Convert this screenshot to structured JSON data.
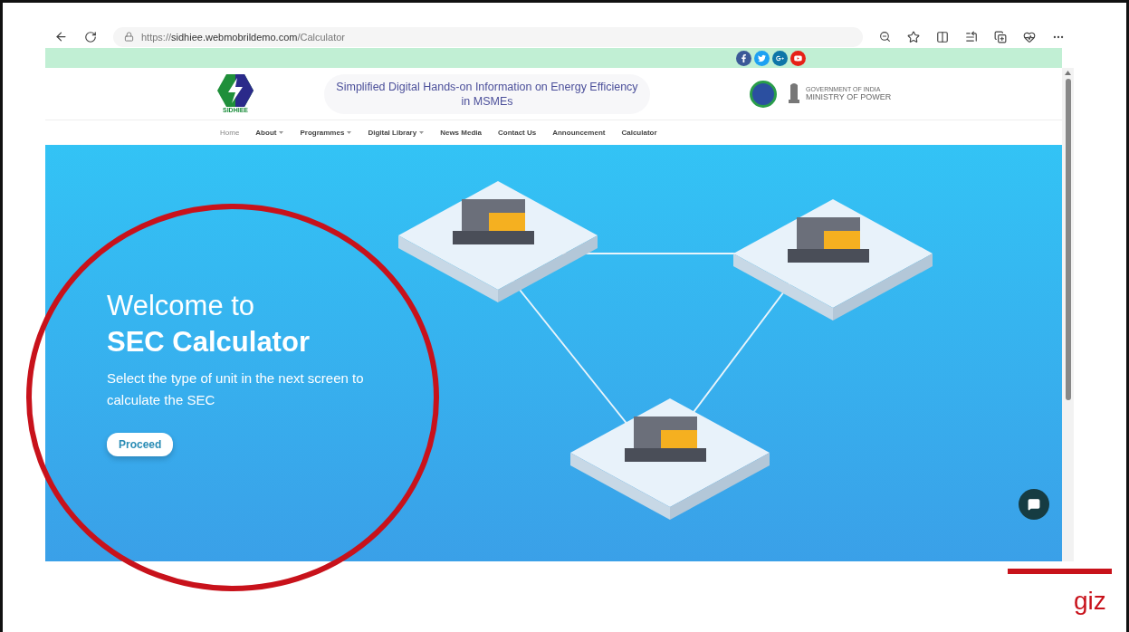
{
  "browser": {
    "url_prefix": "https://",
    "url_host": "sidhiee.webmobrildemo.com",
    "url_path": "/Calculator"
  },
  "site": {
    "logo_text": "SIDHIEE",
    "title": "Simplified Digital Hands-on Information on Energy Efficiency in MSMEs",
    "ministry_small": "GOVERNMENT OF INDIA",
    "ministry": "MINISTRY OF POWER"
  },
  "nav": [
    {
      "label": "Home",
      "selected": true,
      "dropdown": false
    },
    {
      "label": "About",
      "selected": false,
      "dropdown": true
    },
    {
      "label": "Programmes",
      "selected": false,
      "dropdown": true
    },
    {
      "label": "Digital Library",
      "selected": false,
      "dropdown": true
    },
    {
      "label": "News Media",
      "selected": false,
      "dropdown": false
    },
    {
      "label": "Contact Us",
      "selected": false,
      "dropdown": false
    },
    {
      "label": "Announcement",
      "selected": false,
      "dropdown": false
    },
    {
      "label": "Calculator",
      "selected": false,
      "dropdown": false
    }
  ],
  "social": [
    {
      "kind": "facebook",
      "color": "#3b5998"
    },
    {
      "kind": "twitter",
      "color": "#1da1f2"
    },
    {
      "kind": "google",
      "color": "#0e76a8"
    },
    {
      "kind": "youtube",
      "color": "#e62117"
    }
  ],
  "hero": {
    "line1": "Welcome to",
    "line2": "SEC Calculator",
    "text": "Select the type of unit in the next screen to calculate the SEC",
    "button": "Proceed"
  },
  "footer": {
    "brand": "giz"
  }
}
